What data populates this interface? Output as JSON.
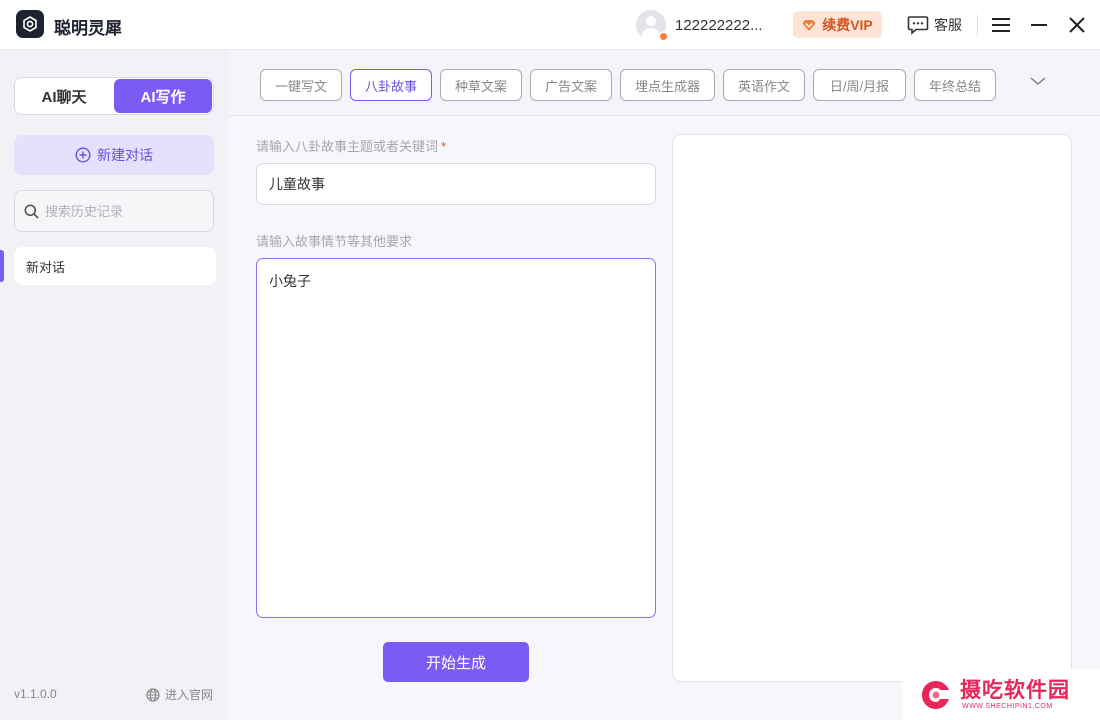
{
  "app": {
    "title": "聪明灵犀"
  },
  "header": {
    "username": "122222222...",
    "vip_label": "续费VIP",
    "service_label": "客服"
  },
  "sidebar": {
    "mode_tabs": [
      {
        "label": "AI聊天",
        "active": false
      },
      {
        "label": "AI写作",
        "active": true
      }
    ],
    "new_chat_label": "新建对话",
    "search_placeholder": "搜索历史记录",
    "history": [
      {
        "label": "新对话"
      }
    ],
    "version": "v1.1.0.0",
    "website_label": "进入官网"
  },
  "tags": [
    {
      "label": "一键写文",
      "active": false
    },
    {
      "label": "八卦故事",
      "active": true
    },
    {
      "label": "种草文案",
      "active": false
    },
    {
      "label": "广告文案",
      "active": false
    },
    {
      "label": "埋点生成器",
      "active": false
    },
    {
      "label": "英语作文",
      "active": false
    },
    {
      "label": "日/周/月报",
      "active": false
    },
    {
      "label": "年终总结",
      "active": false
    }
  ],
  "form": {
    "topic_label": "请输入八卦故事主题或者关键词",
    "required_mark": "*",
    "topic_value": "儿童故事",
    "requirements_label": "请输入故事情节等其他要求",
    "requirements_value": "小兔子",
    "generate_label": "开始生成"
  },
  "watermark": {
    "title": "摄吃软件园",
    "subtitle": "WWW.SHECHIPIN1.COM"
  },
  "colors": {
    "accent": "#7a5cf5",
    "vip_bg": "#fde4d6",
    "vip_text": "#d4561f",
    "watermark": "#e8265a"
  }
}
